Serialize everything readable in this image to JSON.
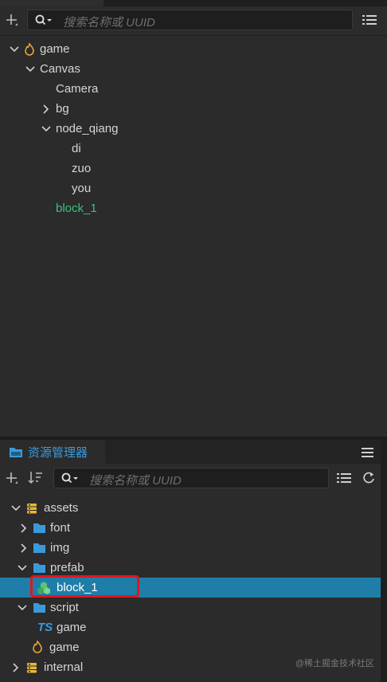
{
  "hierarchy": {
    "search_placeholder": "搜索名称或 UUID",
    "nodes": [
      {
        "label": "game",
        "level": 0,
        "expand": "open",
        "icon": "cocos-scene-icon"
      },
      {
        "label": "Canvas",
        "level": 1,
        "expand": "open"
      },
      {
        "label": "Camera",
        "level": 2,
        "expand": "none"
      },
      {
        "label": "bg",
        "level": 2,
        "expand": "closed"
      },
      {
        "label": "node_qiang",
        "level": 2,
        "expand": "open"
      },
      {
        "label": "di",
        "level": 3,
        "expand": "none"
      },
      {
        "label": "zuo",
        "level": 3,
        "expand": "none"
      },
      {
        "label": "you",
        "level": 3,
        "expand": "none"
      },
      {
        "label": "block_1",
        "level": 2,
        "expand": "none",
        "color": "#3fbf7f"
      }
    ]
  },
  "assets_panel": {
    "tab_title": "资源管理器",
    "search_placeholder": "搜索名称或 UUID",
    "items": [
      {
        "label": "assets",
        "level": 0,
        "expand": "open",
        "icon": "database-icon"
      },
      {
        "label": "font",
        "level": 1,
        "expand": "closed",
        "icon": "folder-icon"
      },
      {
        "label": "img",
        "level": 1,
        "expand": "closed",
        "icon": "folder-icon"
      },
      {
        "label": "prefab",
        "level": 1,
        "expand": "open",
        "icon": "folder-icon"
      },
      {
        "label": "block_1",
        "level": 2,
        "expand": "none",
        "icon": "prefab-icon",
        "selected": true
      },
      {
        "label": "script",
        "level": 1,
        "expand": "open",
        "icon": "folder-icon"
      },
      {
        "label": "game",
        "level": 2,
        "expand": "none",
        "icon": "typescript-icon",
        "icon_text": "TS"
      },
      {
        "label": "game",
        "level": 1,
        "expand": "none",
        "icon": "cocos-scene-icon"
      },
      {
        "label": "internal",
        "level": 0,
        "expand": "closed",
        "icon": "database-icon"
      }
    ]
  },
  "watermark": "@稀土掘金技术社区",
  "colors": {
    "selected_bg": "#1f7ea8",
    "highlight_border": "#e0161f",
    "accent_tab": "#3a9ad9",
    "folder": "#3a9ad9",
    "database": "#e8b73a"
  }
}
